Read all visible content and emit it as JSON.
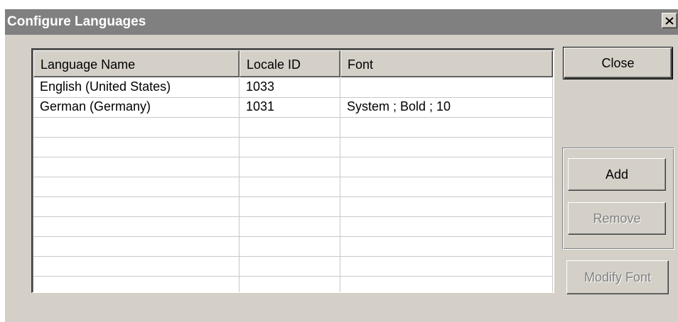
{
  "window": {
    "title": "Configure Languages",
    "close_glyph": "close-x-icon"
  },
  "table": {
    "columns": [
      "Language Name",
      "Locale ID",
      "Font"
    ],
    "rows": [
      [
        "English (United States)",
        "1033",
        ""
      ],
      [
        "German (Germany)",
        "1031",
        "System ; Bold ; 10"
      ],
      [
        "",
        "",
        ""
      ],
      [
        "",
        "",
        ""
      ],
      [
        "",
        "",
        ""
      ],
      [
        "",
        "",
        ""
      ],
      [
        "",
        "",
        ""
      ],
      [
        "",
        "",
        ""
      ],
      [
        "",
        "",
        ""
      ],
      [
        "",
        "",
        ""
      ],
      [
        "",
        "",
        ""
      ]
    ]
  },
  "buttons": {
    "close": "Close",
    "add": "Add",
    "remove": "Remove",
    "modify_font": "Modify Font"
  },
  "colors": {
    "title_bar": "#808080",
    "dialog_face": "#d4d0c8",
    "disabled_text": "#808080"
  }
}
